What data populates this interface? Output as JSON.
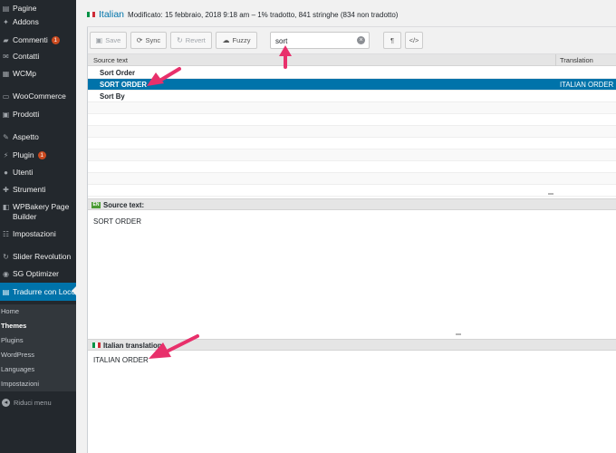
{
  "sidebar": {
    "items": [
      {
        "label": "Pagine",
        "icon": "pages-icon"
      },
      {
        "label": "Addons",
        "icon": "addons-icon"
      },
      {
        "label": "Commenti",
        "icon": "comments-icon",
        "badge": "1"
      },
      {
        "label": "Contatti",
        "icon": "mail-icon"
      },
      {
        "label": "WCMp",
        "icon": "wcmp-icon"
      },
      {
        "label": "WooCommerce",
        "icon": "woocommerce-icon"
      },
      {
        "label": "Prodotti",
        "icon": "products-icon"
      },
      {
        "label": "Aspetto",
        "icon": "appearance-icon"
      },
      {
        "label": "Plugin",
        "icon": "plugin-icon",
        "badge": "1"
      },
      {
        "label": "Utenti",
        "icon": "users-icon"
      },
      {
        "label": "Strumenti",
        "icon": "tools-icon"
      },
      {
        "label": "WPBakery Page Builder",
        "icon": "wpbakery-icon"
      },
      {
        "label": "Impostazioni",
        "icon": "settings-icon"
      },
      {
        "label": "Slider Revolution",
        "icon": "slider-revolution-icon"
      },
      {
        "label": "SG Optimizer",
        "icon": "sg-optimizer-icon"
      },
      {
        "label": "Tradurre con Loco",
        "icon": "loco-translate-icon"
      }
    ],
    "submenu": [
      "Home",
      "Themes",
      "Plugins",
      "WordPress",
      "Languages",
      "Impostazioni"
    ],
    "collapse_label": "Riduci menu",
    "accent": "#0073aa",
    "bg": "#23282d"
  },
  "header": {
    "language": "Italian",
    "meta": "Modificato: 15 febbraio, 2018 9:18 am – 1% tradotto, 841 stringhe (834 non tradotto)"
  },
  "toolbar": {
    "save": "Save",
    "sync": "Sync",
    "revert": "Revert",
    "fuzzy": "Fuzzy",
    "search_value": "sort",
    "pilcrow": "¶",
    "code": "</>"
  },
  "table": {
    "headers": [
      "Source text",
      "Translation"
    ],
    "rows": [
      {
        "source": "Sort Order",
        "translation": ""
      },
      {
        "source": "SORT ORDER",
        "translation": "ITALIAN ORDER"
      },
      {
        "source": "Sort By",
        "translation": ""
      }
    ]
  },
  "source_pane": {
    "badge": "EN",
    "label": "Source text:",
    "text": "SORT ORDER"
  },
  "translation_pane": {
    "label": "Italian translation:",
    "text": "ITALIAN ORDER"
  },
  "annotation_color": "#e8306b"
}
